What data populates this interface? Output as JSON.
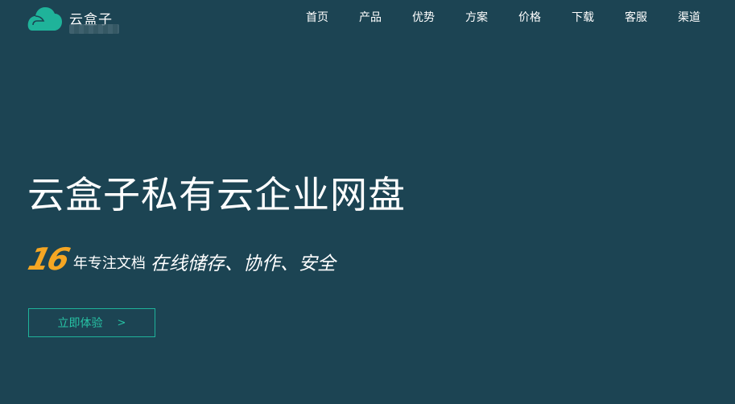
{
  "brand": {
    "name": "云盒子",
    "accent": "#1fb39a"
  },
  "nav": {
    "items": [
      "首页",
      "产品",
      "优势",
      "方案",
      "价格",
      "下载",
      "客服",
      "渠道"
    ]
  },
  "hero": {
    "title": "云盒子私有云企业网盘",
    "years_value": "16",
    "years_label": "年专注文档",
    "slogan": "在线储存、协作、安全",
    "years_color": "#f5a623",
    "background": "#1c4453"
  },
  "cta": {
    "label": "立即体验",
    "icon": "chevron-right-icon"
  }
}
